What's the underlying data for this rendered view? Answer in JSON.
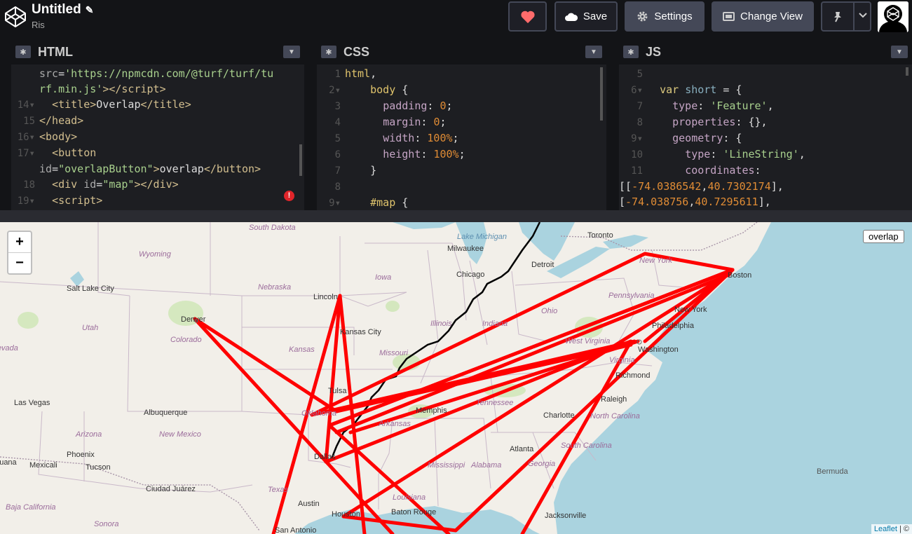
{
  "header": {
    "title": "Untitled",
    "author": "Ris",
    "save_label": "Save",
    "settings_label": "Settings",
    "change_view_label": "Change View"
  },
  "panes": {
    "html": {
      "title": "HTML"
    },
    "css": {
      "title": "CSS"
    },
    "js": {
      "title": "JS"
    }
  },
  "map": {
    "zoom_in": "+",
    "zoom_out": "−",
    "overlap_button": "overlap",
    "attribution_link": "Leaflet",
    "attribution_rest": " | ©",
    "places": [
      {
        "name": "South Dakota",
        "kind": "state"
      },
      {
        "name": "Wyoming",
        "kind": "state"
      },
      {
        "name": "Nebraska",
        "kind": "state"
      },
      {
        "name": "Iowa",
        "kind": "state"
      },
      {
        "name": "Colorado",
        "kind": "state"
      },
      {
        "name": "Kansas",
        "kind": "state"
      },
      {
        "name": "Utah",
        "kind": "state"
      },
      {
        "name": "Illinois",
        "kind": "state"
      },
      {
        "name": "Indiana",
        "kind": "state"
      },
      {
        "name": "Ohio",
        "kind": "state"
      },
      {
        "name": "Pennsylvania",
        "kind": "state"
      },
      {
        "name": "New York",
        "kind": "state"
      },
      {
        "name": "Missouri",
        "kind": "state"
      },
      {
        "name": "Oklahoma",
        "kind": "state"
      },
      {
        "name": "Arkansas",
        "kind": "state"
      },
      {
        "name": "Tennessee",
        "kind": "state"
      },
      {
        "name": "West Virginia",
        "kind": "state"
      },
      {
        "name": "Virginia",
        "kind": "state"
      },
      {
        "name": "North Carolina",
        "kind": "state"
      },
      {
        "name": "South Carolina",
        "kind": "state"
      },
      {
        "name": "Georgia",
        "kind": "state"
      },
      {
        "name": "Alabama",
        "kind": "state"
      },
      {
        "name": "Mississippi",
        "kind": "state"
      },
      {
        "name": "Louisiana",
        "kind": "state"
      },
      {
        "name": "Texas",
        "kind": "state"
      },
      {
        "name": "Arizona",
        "kind": "state"
      },
      {
        "name": "New Mexico",
        "kind": "state"
      },
      {
        "name": "Nevada",
        "kind": "state"
      },
      {
        "name": "Sonora",
        "kind": "state"
      },
      {
        "name": "Baja California",
        "kind": "state"
      },
      {
        "name": "Lake Michigan",
        "kind": "water"
      },
      {
        "name": "Toronto",
        "kind": "city"
      },
      {
        "name": "Milwaukee",
        "kind": "city"
      },
      {
        "name": "Detroit",
        "kind": "city"
      },
      {
        "name": "Chicago",
        "kind": "city"
      },
      {
        "name": "Boston",
        "kind": "city"
      },
      {
        "name": "Salt Lake City",
        "kind": "city"
      },
      {
        "name": "Lincoln",
        "kind": "city"
      },
      {
        "name": "Denver",
        "kind": "city"
      },
      {
        "name": "Kansas City",
        "kind": "city"
      },
      {
        "name": "New York",
        "kind": "city"
      },
      {
        "name": "Philadelphia",
        "kind": "city"
      },
      {
        "name": "Washington",
        "kind": "city"
      },
      {
        "name": "Richmond",
        "kind": "city"
      },
      {
        "name": "Las Vegas",
        "kind": "city"
      },
      {
        "name": "Tulsa",
        "kind": "city"
      },
      {
        "name": "Albuquerque",
        "kind": "city"
      },
      {
        "name": "Memphis",
        "kind": "city"
      },
      {
        "name": "Raleigh",
        "kind": "city"
      },
      {
        "name": "Charlotte",
        "kind": "city"
      },
      {
        "name": "Phoenix",
        "kind": "city"
      },
      {
        "name": "Atlanta",
        "kind": "city"
      },
      {
        "name": "Mexicali",
        "kind": "city"
      },
      {
        "name": "Tucson",
        "kind": "city"
      },
      {
        "name": "Dallas",
        "kind": "city"
      },
      {
        "name": "Ciudad Juárez",
        "kind": "city"
      },
      {
        "name": "Austin",
        "kind": "city"
      },
      {
        "name": "Houston",
        "kind": "city"
      },
      {
        "name": "Baton Rouge",
        "kind": "city"
      },
      {
        "name": "Jacksonville",
        "kind": "city"
      },
      {
        "name": "San Antonio",
        "kind": "city"
      },
      {
        "name": "Tijuana",
        "kind": "city"
      },
      {
        "name": "Bermuda",
        "kind": "island"
      }
    ]
  },
  "colors": {
    "accent_heart": "#ff6b6b",
    "route": "#ff0000",
    "line": "#000000",
    "water": "#aad3df",
    "land": "#f2efe9"
  }
}
